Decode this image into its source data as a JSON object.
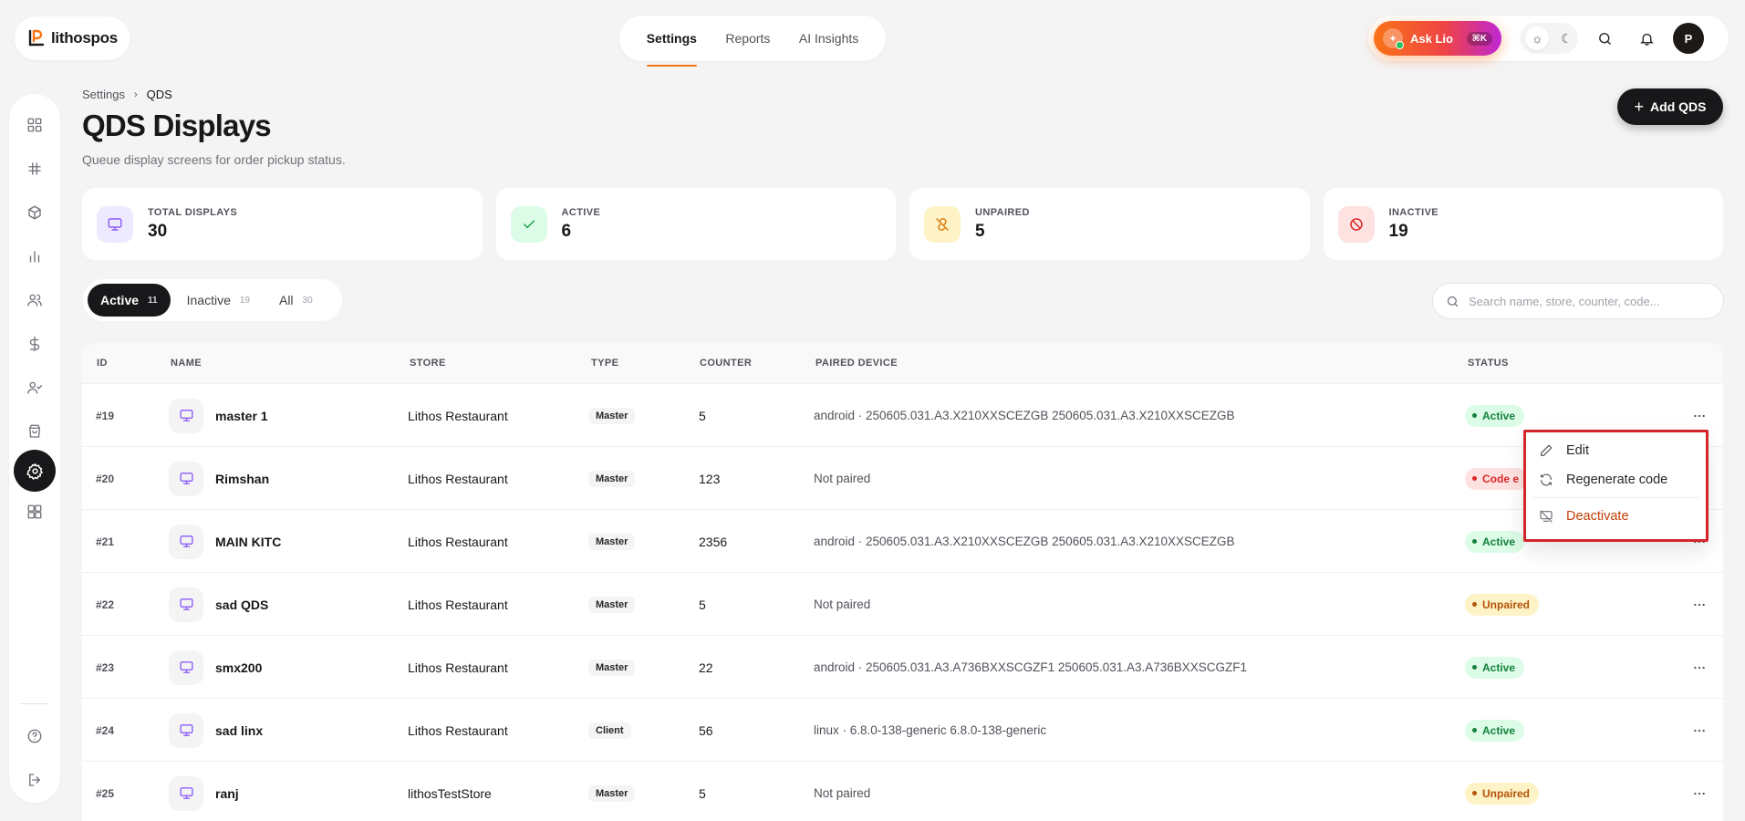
{
  "brand": {
    "name": "lithospos"
  },
  "topnav": {
    "tabs": [
      {
        "label": "Settings"
      },
      {
        "label": "Reports"
      },
      {
        "label": "AI Insights"
      }
    ]
  },
  "assistant": {
    "label": "Ask Lio",
    "shortcut": "⌘K"
  },
  "user": {
    "initials": "P"
  },
  "breadcrumb": {
    "parent": "Settings",
    "current": "QDS"
  },
  "page": {
    "title": "QDS Displays",
    "subtitle": "Queue display screens for order pickup status.",
    "add_label": "Add QDS"
  },
  "stats": [
    {
      "label": "TOTAL DISPLAYS",
      "value": "30",
      "icon": "monitor-icon",
      "color": "#8b5cf6"
    },
    {
      "label": "ACTIVE",
      "value": "6",
      "icon": "check-icon",
      "color": "#16a34a"
    },
    {
      "label": "UNPAIRED",
      "value": "5",
      "icon": "unlink-icon",
      "color": "#d97706"
    },
    {
      "label": "INACTIVE",
      "value": "19",
      "icon": "ban-icon",
      "color": "#dc2626"
    }
  ],
  "filters": [
    {
      "label": "Active",
      "count": "11"
    },
    {
      "label": "Inactive",
      "count": "19"
    },
    {
      "label": "All",
      "count": "30"
    }
  ],
  "search": {
    "placeholder": "Search name, store, counter, code..."
  },
  "table": {
    "columns": {
      "id": "ID",
      "name": "NAME",
      "store": "STORE",
      "type": "TYPE",
      "counter": "COUNTER",
      "device": "PAIRED DEVICE",
      "status": "STATUS"
    },
    "rows": [
      {
        "id": "#19",
        "name": "master 1",
        "store": "Lithos Restaurant",
        "type": "Master",
        "counter": "5",
        "device": "android · 250605.031.A3.X210XXSCEZGB 250605.031.A3.X210XXSCEZGB",
        "status": "Active"
      },
      {
        "id": "#20",
        "name": "Rimshan",
        "store": "Lithos Restaurant",
        "type": "Master",
        "counter": "123",
        "device": "Not paired",
        "status": "Code e"
      },
      {
        "id": "#21",
        "name": "MAIN KITC",
        "store": "Lithos Restaurant",
        "type": "Master",
        "counter": "2356",
        "device": "android · 250605.031.A3.X210XXSCEZGB 250605.031.A3.X210XXSCEZGB",
        "status": "Active"
      },
      {
        "id": "#22",
        "name": "sad QDS",
        "store": "Lithos Restaurant",
        "type": "Master",
        "counter": "5",
        "device": "Not paired",
        "status": "Unpaired"
      },
      {
        "id": "#23",
        "name": "smx200",
        "store": "Lithos Restaurant",
        "type": "Master",
        "counter": "22",
        "device": "android · 250605.031.A3.A736BXXSCGZF1 250605.031.A3.A736BXXSCGZF1",
        "status": "Active"
      },
      {
        "id": "#24",
        "name": "sad linx",
        "store": "Lithos Restaurant",
        "type": "Client",
        "counter": "56",
        "device": "linux · 6.8.0-138-generic 6.8.0-138-generic",
        "status": "Active"
      },
      {
        "id": "#25",
        "name": "ranj",
        "store": "lithosTestStore",
        "type": "Master",
        "counter": "5",
        "device": "Not paired",
        "status": "Unpaired"
      }
    ]
  },
  "row_menu": {
    "edit": "Edit",
    "regenerate": "Regenerate code",
    "deactivate": "Deactivate"
  }
}
